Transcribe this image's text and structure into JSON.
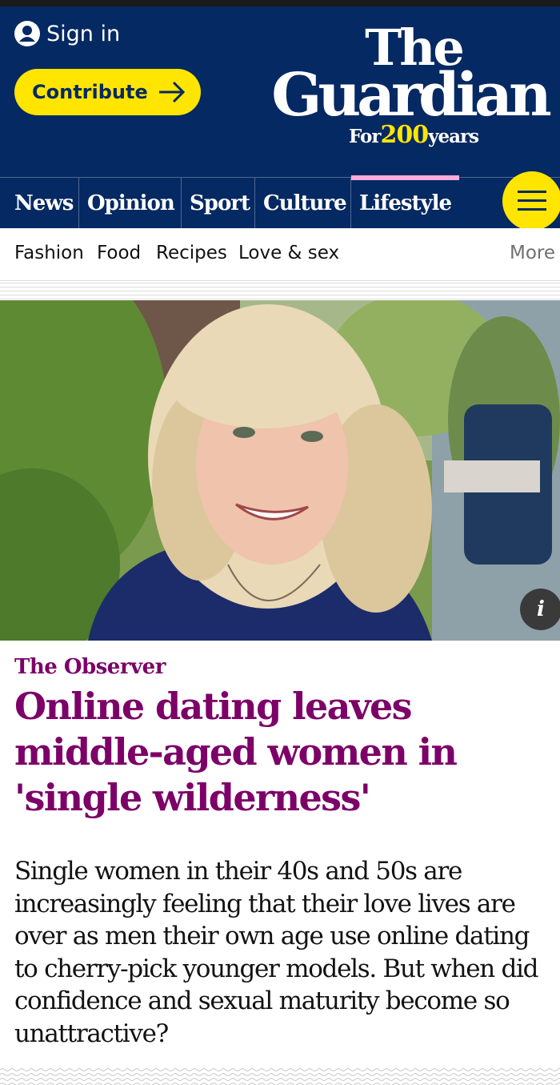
{
  "header": {
    "sign_in_label": "Sign in",
    "contribute_label": "Contribute",
    "logo": {
      "line1": "The",
      "line2": "Guardian",
      "tagline_prefix": "For",
      "tagline_number": "200",
      "tagline_suffix": "years"
    }
  },
  "nav": {
    "items": [
      {
        "label": "News"
      },
      {
        "label": "Opinion"
      },
      {
        "label": "Sport"
      },
      {
        "label": "Culture"
      },
      {
        "label": "Lifestyle",
        "active": true
      }
    ],
    "menu_icon": "hamburger-icon"
  },
  "subnav": {
    "items": [
      "Fashion",
      "Food",
      "Recipes",
      "Love & sex"
    ],
    "more_label": "More"
  },
  "article": {
    "image_alt": "Smiling woman with curly blonde hair in a garden",
    "info_icon_label": "i",
    "kicker": "The Observer",
    "headline": "Online dating leaves middle-aged women in 'single wilderness'",
    "standfirst": "Single women in their 40s and 50s are increasingly feeling that their love lives are over as men their own age use online dating to cherry-pick younger models. But when did confidence and sexual maturity become so unattractive?"
  },
  "colors": {
    "brand_blue": "#052962",
    "contribute_yellow": "#ffe500",
    "lifestyle_accent": "#7d0068",
    "active_tab_pink": "#ffabdb"
  }
}
